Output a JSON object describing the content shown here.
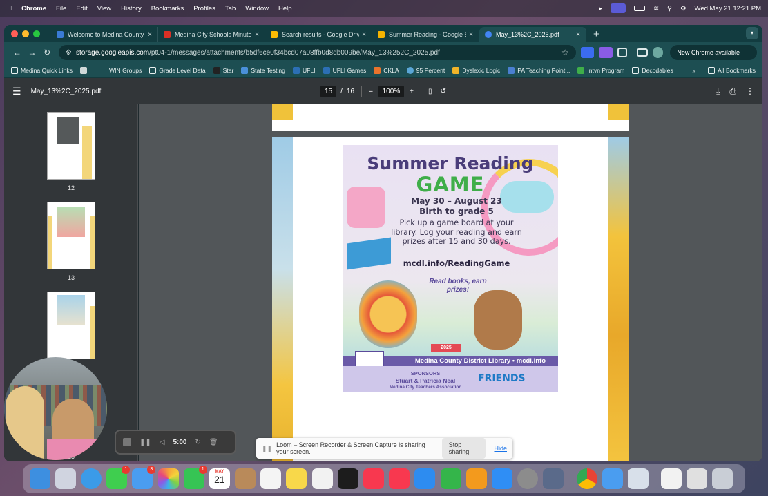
{
  "menubar": {
    "app": "Chrome",
    "items": [
      "File",
      "Edit",
      "View",
      "History",
      "Bookmarks",
      "Profiles",
      "Tab",
      "Window",
      "Help"
    ],
    "datetime": "Wed May 21  12:21 PM"
  },
  "tabs": [
    {
      "label": "Welcome to Medina County D",
      "color": "#3a7bd5"
    },
    {
      "label": "Medina City Schools Minute M",
      "color": "#d93025"
    },
    {
      "label": "Search results - Google Drive",
      "color": "#fbbc04"
    },
    {
      "label": "Summer Reading - Google Sli",
      "color": "#f4b400"
    },
    {
      "label": "May_13%2C_2025.pdf",
      "color": "#4285f4"
    }
  ],
  "address": {
    "host": "storage.googleapis.com",
    "path": "/pt04-1/messages/attachments/b5df6ce0f34bcd07a08ffb0d8db009be/May_13%252C_2025.pdf"
  },
  "new_chrome_label": "New Chrome available",
  "bookmarks": {
    "items": [
      {
        "label": "Medina Quick Links",
        "color": "#7a8a8a"
      },
      {
        "label": "WIN Groups",
        "color": "#cfd8d8"
      },
      {
        "label": "Grade Level Data",
        "color": "#cfd8d8"
      },
      {
        "label": "Star",
        "color": "#222222"
      },
      {
        "label": "State Testing",
        "color": "#4a90d9"
      },
      {
        "label": "UFLI",
        "color": "#2c6fb5"
      },
      {
        "label": "UFLI Games",
        "color": "#2c6fb5"
      },
      {
        "label": "CKLA",
        "color": "#e8732c"
      },
      {
        "label": "95 Percent",
        "color": "#5aa6d6"
      },
      {
        "label": "Dyslexic Logic",
        "color": "#f0b429"
      },
      {
        "label": "PA Teaching Point...",
        "color": "#4a7fd0"
      },
      {
        "label": "Intvn Program",
        "color": "#3fae49"
      },
      {
        "label": "Decodables",
        "color": "#cfd8d8"
      }
    ],
    "overflow": "»",
    "all": "All Bookmarks"
  },
  "pdf": {
    "filename": "May_13%2C_2025.pdf",
    "page_current": "15",
    "page_sep": "/",
    "page_total": "16",
    "zoom": "100%",
    "thumb_labels": [
      "12",
      "13",
      "15"
    ]
  },
  "flyer": {
    "title1": "Summer Reading",
    "title2": "GAME",
    "dates": "May 30 – August 23",
    "ages": "Birth to grade 5",
    "body": "Pick up a game board at your library. Log your reading and earn prizes after 15 and 30 days.",
    "url": "mcdl.info/ReadingGame",
    "tagline": "Read books, earn prizes!",
    "year": "2025",
    "footer": "Medina County District Library • mcdl.info",
    "sponsors_label": "SPONSORS",
    "sponsors_names": "Stuart & Patricia Neal",
    "sponsors_org": "Medina City Teachers Association",
    "friends": "FRIENDS"
  },
  "loom": {
    "message": "Loom – Screen Recorder & Screen Capture is sharing your screen.",
    "stop_label": "Stop sharing",
    "hide_label": "Hide"
  },
  "recorder": {
    "time": "5:00"
  },
  "dock": {
    "apps": [
      {
        "name": "finder",
        "color": "#3d8fe0"
      },
      {
        "name": "launchpad",
        "color": "#d0d4e0"
      },
      {
        "name": "safari",
        "color": "#3b9be8"
      },
      {
        "name": "messages",
        "color": "#3fce4f",
        "badge": "1"
      },
      {
        "name": "mail",
        "color": "#4a9df0",
        "badge": "3"
      },
      {
        "name": "photos",
        "color": "#f7f7f7"
      },
      {
        "name": "facetime",
        "color": "#36c454",
        "badge": "1"
      },
      {
        "name": "calendar",
        "color": "#ffffff"
      },
      {
        "name": "contacts",
        "color": "#b98a5a"
      },
      {
        "name": "reminders",
        "color": "#f4f4f4"
      },
      {
        "name": "notes",
        "color": "#f8d84a"
      },
      {
        "name": "freeform",
        "color": "#f2f2f2"
      },
      {
        "name": "tv",
        "color": "#1c1c1c"
      },
      {
        "name": "music",
        "color": "#f8384f"
      },
      {
        "name": "news",
        "color": "#f8384f"
      },
      {
        "name": "keynote",
        "color": "#2d8cf0"
      },
      {
        "name": "numbers",
        "color": "#34b54a"
      },
      {
        "name": "pages",
        "color": "#f39a1d"
      },
      {
        "name": "app-store",
        "color": "#2f8ef5"
      },
      {
        "name": "system-settings",
        "color": "#8c8c8c"
      },
      {
        "name": "iphone-mirroring",
        "color": "#5a6a8a"
      },
      {
        "name": "chrome",
        "color": "#e8e8e8"
      },
      {
        "name": "files",
        "color": "#4a9df0"
      },
      {
        "name": "preview",
        "color": "#d8e0ea"
      },
      {
        "name": "document",
        "color": "#f2f2f2"
      },
      {
        "name": "screenshot",
        "color": "#e0e0e0"
      },
      {
        "name": "trash",
        "color": "#c9ced6"
      }
    ],
    "calendar_month": "MAY",
    "calendar_day": "21"
  }
}
